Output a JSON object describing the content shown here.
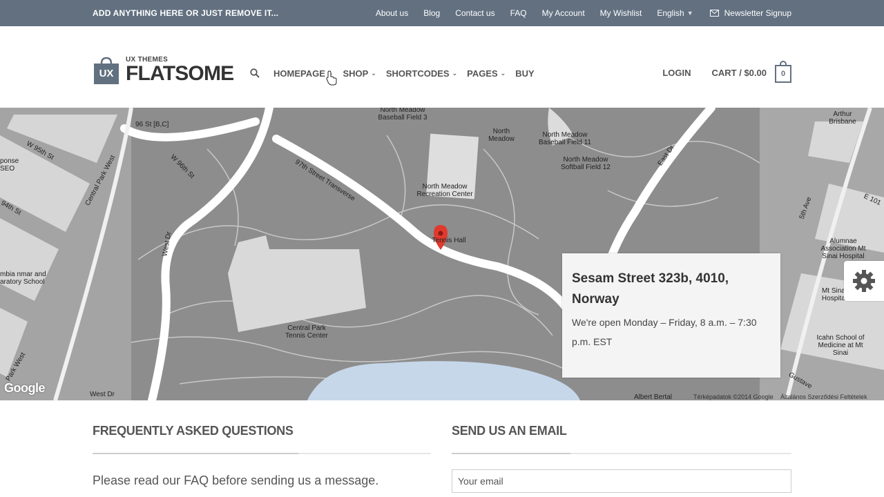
{
  "topbar": {
    "announce": "ADD ANYTHING HERE OR JUST REMOVE IT...",
    "links": [
      "About us",
      "Blog",
      "Contact us",
      "FAQ",
      "My Account",
      "My Wishlist"
    ],
    "language": "English",
    "newsletter": "Newsletter Signup"
  },
  "logo": {
    "small": "UX THEMES",
    "big": "FLATSOME",
    "mark": "UX"
  },
  "nav": {
    "items": [
      {
        "label": "HOMEPAGE",
        "has_dropdown": true
      },
      {
        "label": "SHOP",
        "has_dropdown": true
      },
      {
        "label": "SHORTCODES",
        "has_dropdown": true
      },
      {
        "label": "PAGES",
        "has_dropdown": true
      },
      {
        "label": "BUY",
        "has_dropdown": false
      }
    ]
  },
  "header_right": {
    "login": "LOGIN",
    "cart": "CART / $0.00",
    "cart_count": "0"
  },
  "map": {
    "labels": {
      "w96st": "96 St [B,C]",
      "w95th": "W 95th St",
      "w96th": "W 96th St",
      "cpw": "Central Park West",
      "westdr": "West Dr",
      "transverse97": "97th Street Transverse",
      "nmbf3": "North Meadow Baseball Field 3",
      "nm": "North Meadow",
      "nmbf11": "North Meadow Baseball Field 11",
      "nmsf12": "North Meadow Softball Field 12",
      "nmrc": "North Meadow Recreation Center",
      "tennis_hall": "Tennis Hall",
      "cptc": "Central Park Tennis Center",
      "eastdr": "East Dr",
      "alumnae": "Alumnae Association Mt Sinai Hospital",
      "mtsinai": "Mt Sinai Hospital",
      "icahn": "Icahn School of Medicine at Mt Sinai",
      "fifthave": "5th Ave",
      "e101": "E 101",
      "arthur": "Arthur Brisbane",
      "seo": "ponse SEO",
      "94th": "94th St",
      "school": "mbia nmar and aratory School",
      "parkwest": "Park West",
      "westdr2": "West Dr",
      "gustave": "Gustave",
      "albert": "Albert Bertal"
    },
    "copyright": "Térképadatok ©2014 Google",
    "terms": "Általános Szerződési Feltételek",
    "google": "Google"
  },
  "infobox": {
    "address": "Sesam Street 323b, 4010, Norway",
    "hours": "We're open Monday – Friday, 8 a.m. – 7:30 p.m. EST"
  },
  "faq": {
    "heading": "FREQUENTLY ASKED QUESTIONS",
    "text_before": "Please read our ",
    "link": "FAQ",
    "text_after": " before sending us a message."
  },
  "email": {
    "heading": "SEND US AN EMAIL",
    "placeholder": "Your email"
  },
  "colors": {
    "topbar": "#627080",
    "map_park": "#8d8d8d",
    "map_road": "#ffffff",
    "water": "#c7d7ea"
  }
}
